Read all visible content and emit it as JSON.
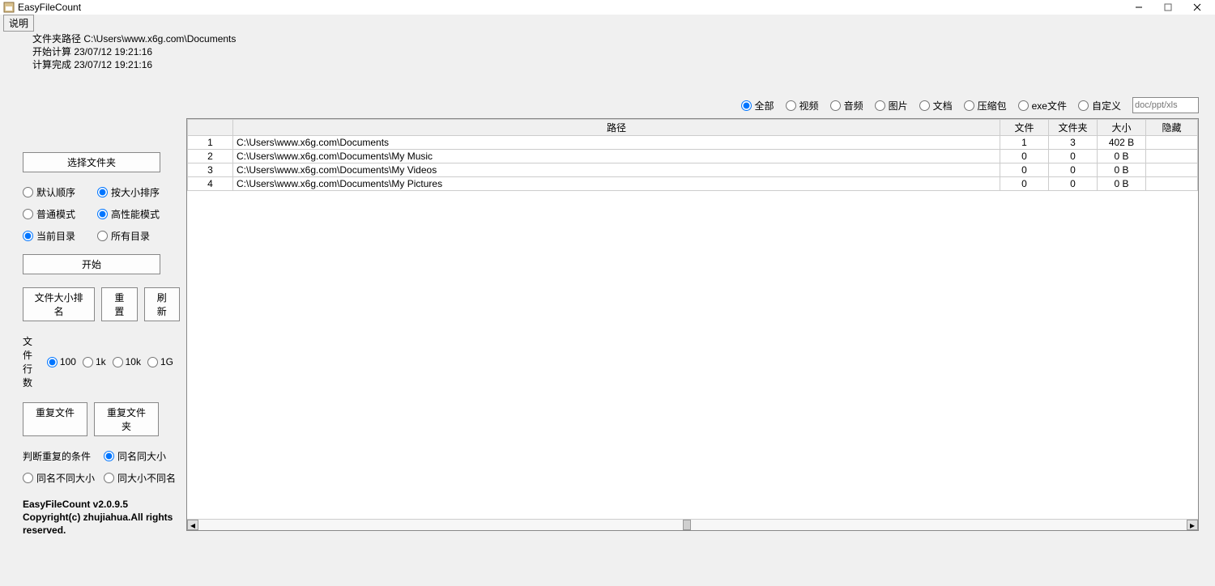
{
  "window": {
    "title": "EasyFileCount"
  },
  "menu": {
    "help": "说明"
  },
  "info": {
    "path_label": "文件夹路径 C:\\Users\\www.x6g.com\\Documents",
    "start_label": "开始计算 23/07/12 19:21:16",
    "done_label": "计算完成 23/07/12 19:21:16"
  },
  "sidebar": {
    "choose_folder": "选择文件夹",
    "sort_default": "默认顺序",
    "sort_size": "按大小排序",
    "mode_normal": "普通模式",
    "mode_high": "高性能模式",
    "dir_current": "当前目录",
    "dir_all": "所有目录",
    "start": "开始",
    "filesize_sort": "文件大小排名",
    "reset": "重置",
    "refresh": "刷新",
    "rowcount_label": "文件行数",
    "rowcount_opts": [
      "100",
      "1k",
      "10k",
      "1G"
    ],
    "dup_file": "重复文件",
    "dup_folder": "重复文件夹",
    "dup_cond_label": "判断重复的条件",
    "dup_same_name_size": "同名同大小",
    "dup_same_name_diff_size": "同名不同大小",
    "dup_same_size_diff_name": "同大小不同名",
    "version": "EasyFileCount v2.0.9.5",
    "copyright": "Copyright(c) zhujiahua.All rights reserved."
  },
  "filters": {
    "all": "全部",
    "video": "视频",
    "audio": "音频",
    "image": "图片",
    "doc": "文档",
    "archive": "压缩包",
    "exe": "exe文件",
    "custom": "自定义",
    "custom_placeholder": "doc/ppt/xls"
  },
  "table": {
    "headers": {
      "path": "路径",
      "files": "文件",
      "folders": "文件夹",
      "size": "大小",
      "hidden": "隐藏"
    },
    "rows": [
      {
        "idx": "1",
        "path": "C:\\Users\\www.x6g.com\\Documents",
        "files": "1",
        "folders": "3",
        "size": "402 B",
        "hidden": ""
      },
      {
        "idx": "2",
        "path": "C:\\Users\\www.x6g.com\\Documents\\My Music",
        "files": "0",
        "folders": "0",
        "size": "0 B",
        "hidden": ""
      },
      {
        "idx": "3",
        "path": "C:\\Users\\www.x6g.com\\Documents\\My Videos",
        "files": "0",
        "folders": "0",
        "size": "0 B",
        "hidden": ""
      },
      {
        "idx": "4",
        "path": "C:\\Users\\www.x6g.com\\Documents\\My Pictures",
        "files": "0",
        "folders": "0",
        "size": "0 B",
        "hidden": ""
      }
    ]
  }
}
